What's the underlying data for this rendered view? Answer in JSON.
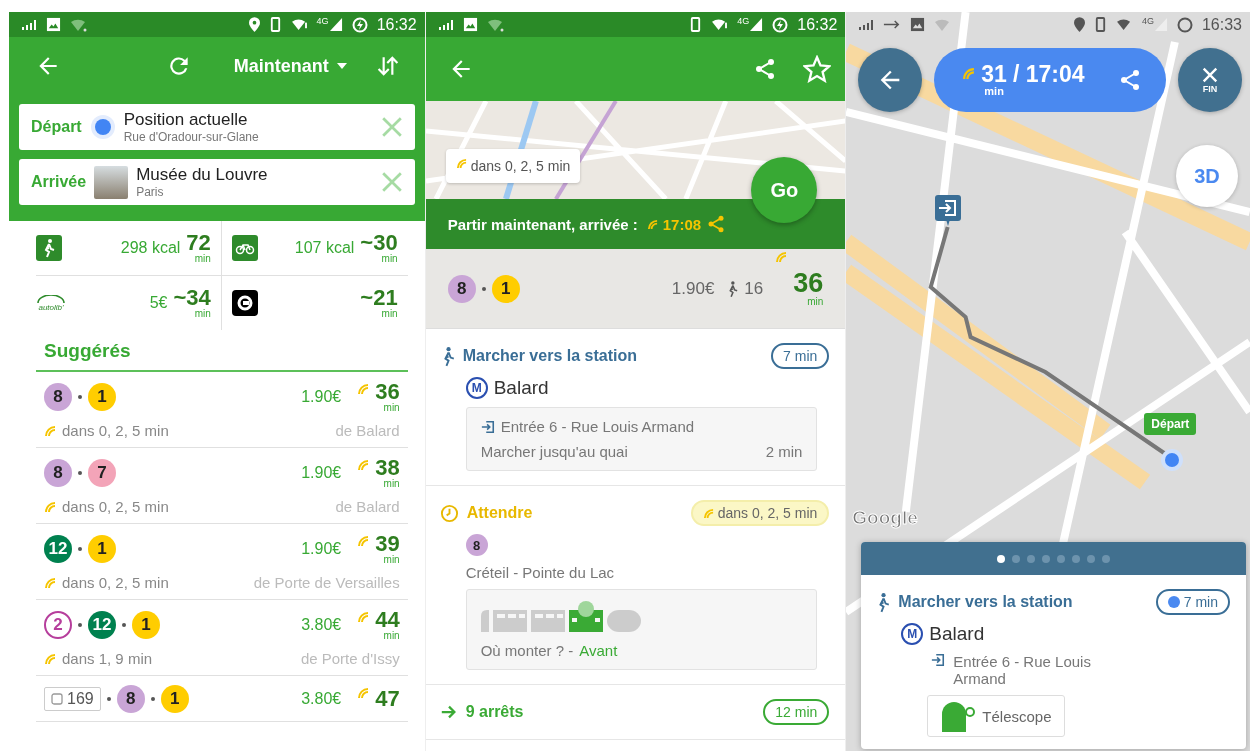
{
  "list_screen": {
    "status_bar": {
      "network": "4G",
      "time": "16:32"
    },
    "toolbar": {
      "time_selector": "Maintenant"
    },
    "departure": {
      "label": "Départ",
      "title": "Position actuelle",
      "subtitle": "Rue d'Oradour-sur-Glane"
    },
    "arrival": {
      "label": "Arrivée",
      "title": "Musée du Louvre",
      "subtitle": "Paris"
    },
    "modes": [
      {
        "kind": "walk",
        "detail": "298 kcal",
        "duration": "72",
        "unit": "min"
      },
      {
        "kind": "bike",
        "detail": "107 kcal",
        "duration": "~30",
        "unit": "min"
      },
      {
        "kind": "carshare",
        "logo": "autolib'",
        "detail": "5€",
        "duration": "~34",
        "unit": "min"
      },
      {
        "kind": "taxi",
        "duration": "~21",
        "unit": "min"
      }
    ],
    "section_title": "Suggérés",
    "routes": [
      {
        "lines": [
          {
            "kind": "filled",
            "label": "8",
            "color": "#c9a5d6"
          },
          {
            "kind": "filled",
            "label": "1",
            "color": "#ffcd00"
          }
        ],
        "price": "1.90€",
        "duration": "36",
        "unit": "min",
        "wait": "dans 0, 2, 5 min",
        "origin": "de Balard"
      },
      {
        "lines": [
          {
            "kind": "filled",
            "label": "8",
            "color": "#c9a5d6"
          },
          {
            "kind": "filled",
            "label": "7",
            "color": "#f3a4b8"
          }
        ],
        "price": "1.90€",
        "duration": "38",
        "unit": "min",
        "wait": "dans 0, 2, 5 min",
        "origin": "de Balard"
      },
      {
        "lines": [
          {
            "kind": "filled",
            "label": "12",
            "color": "#00814f"
          },
          {
            "kind": "filled",
            "label": "1",
            "color": "#ffcd00"
          }
        ],
        "price": "1.90€",
        "duration": "39",
        "unit": "min",
        "wait": "dans 0, 2, 5 min",
        "origin": "de Porte de Versailles"
      },
      {
        "lines": [
          {
            "kind": "ring",
            "label": "2",
            "color": "#b63e9c"
          },
          {
            "kind": "filled",
            "label": "12",
            "color": "#00814f"
          },
          {
            "kind": "filled",
            "label": "1",
            "color": "#ffcd00"
          }
        ],
        "price": "3.80€",
        "duration": "44",
        "unit": "min",
        "wait": "dans 1, 9 min",
        "origin": "de Porte d'Issy"
      },
      {
        "lines": [
          {
            "kind": "bus",
            "label": "169",
            "color": "#ffffff"
          },
          {
            "kind": "filled",
            "label": "8",
            "color": "#c9a5d6"
          },
          {
            "kind": "filled",
            "label": "1",
            "color": "#ffcd00"
          }
        ],
        "price": "3.80€",
        "duration": "47"
      }
    ]
  },
  "detail_screen": {
    "status_bar": {
      "network": "4G",
      "time": "16:32"
    },
    "map_bubble": "dans 0, 2, 5 min",
    "go_button": "Go",
    "banner": {
      "text": "Partir maintenant, arrivée :",
      "arrival": "17:08"
    },
    "summary": {
      "lines": [
        {
          "kind": "filled",
          "label": "8",
          "color": "#c9a5d6"
        },
        {
          "kind": "filled",
          "label": "1",
          "color": "#ffcd00"
        }
      ],
      "price": "1.90€",
      "walk": "16",
      "duration": "36",
      "unit": "min"
    },
    "steps": [
      {
        "kind": "walk",
        "title": "Marcher vers la station",
        "badge": "7 min",
        "station_symbol": "M",
        "station": "Balard",
        "entrance": "Entrée 6 - Rue Louis Armand",
        "note": "Marcher jusqu'au quai",
        "note_time": "2 min"
      },
      {
        "kind": "wait",
        "title": "Attendre",
        "badge": "dans 0, 2, 5 min",
        "line": {
          "kind": "filled",
          "label": "8",
          "color": "#c9a5d6"
        },
        "direction": "Créteil - Pointe du Lac",
        "boarding": "Où monter ? -",
        "boarding_position": "Avant"
      },
      {
        "kind": "ride",
        "title": "9 arrêts",
        "badge": "12 min"
      }
    ]
  },
  "navigation_screen": {
    "status_bar": {
      "network": "4G",
      "time": "16:33"
    },
    "eta": {
      "minutes": "31",
      "rest": "/ 17:04",
      "unit": "min"
    },
    "end_button": "FIN",
    "view_button": "3D",
    "start_marker": "Départ",
    "map_attribution": "Google",
    "pager": [
      {
        "selected": true
      },
      {
        "selected": false
      },
      {
        "selected": false
      },
      {
        "selected": false
      },
      {
        "selected": false
      },
      {
        "selected": false
      },
      {
        "selected": false
      },
      {
        "selected": false
      }
    ],
    "card": {
      "title": "Marcher vers la station",
      "badge": "7 min",
      "station_symbol": "M",
      "station": "Balard",
      "entrance": "Entrée 6 - Rue Louis Armand",
      "exit_tool": "Télescope"
    }
  }
}
